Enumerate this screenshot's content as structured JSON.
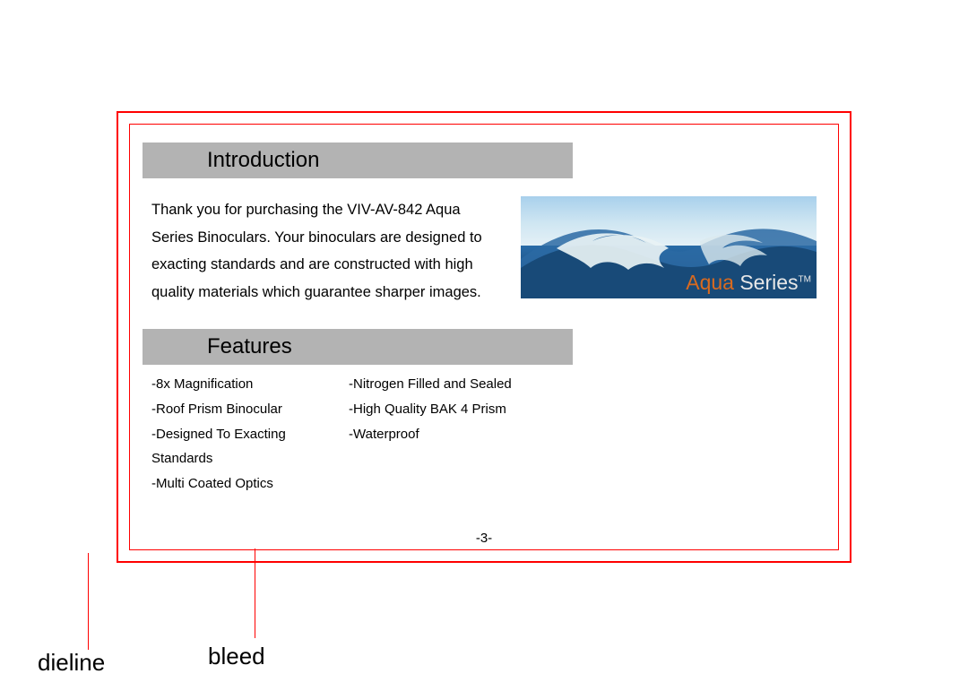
{
  "sections": {
    "introduction": {
      "heading": "Introduction",
      "body": "Thank you for purchasing the VIV-AV-842 Aqua Series Binoculars. Your binoculars are designed to exacting standards and are constructed with high quality materials which guarantee sharper images."
    },
    "features": {
      "heading": "Features",
      "col1": {
        "i0": "-8x Magnification",
        "i1": "-Roof Prism Binocular",
        "i2": "-Designed To Exacting Standards",
        "i3": "-Multi Coated Optics"
      },
      "col2": {
        "i0": "-Nitrogen Filled and Sealed",
        "i1": "-High Quality BAK 4 Prism",
        "i2": "-Waterproof"
      }
    }
  },
  "brand": {
    "aqua": "Aqua ",
    "series": "Series",
    "tm": "TM"
  },
  "page_number": "-3-",
  "callouts": {
    "dieline": "dieline",
    "bleed": "bleed"
  }
}
